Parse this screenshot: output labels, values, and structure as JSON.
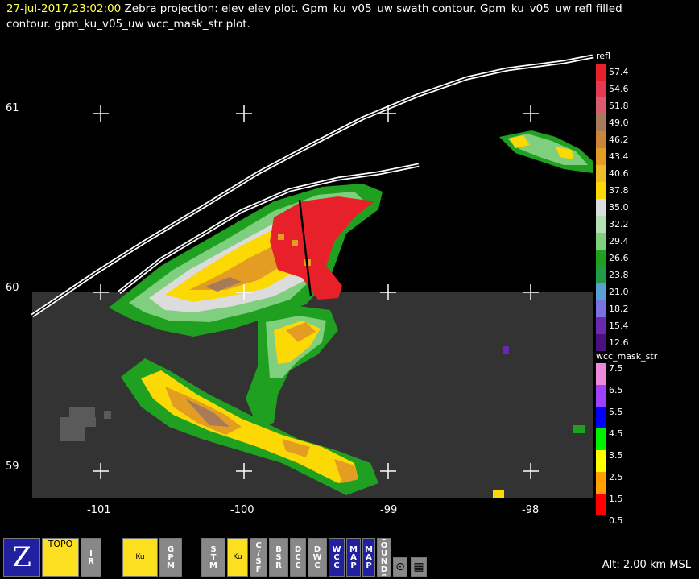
{
  "title": {
    "timestamp": "27-jul-2017,23:02:00",
    "text_line1": "  Zebra projection: elev elev  plot.  Gpm_ku_v05_uw swath contour.  Gpm_ku_v05_uw refl filled",
    "text_line2": "contour.  gpm_ku_v05_uw wcc_mask_str  plot."
  },
  "axes": {
    "lat_labels": [
      "61",
      "60",
      "59"
    ],
    "lon_labels": [
      "-101",
      "-100",
      "-99",
      "-98"
    ]
  },
  "colorbars": {
    "refl": {
      "title": "refl",
      "labels": [
        "57.4",
        "54.6",
        "51.8",
        "49.0",
        "46.2",
        "43.4",
        "40.6",
        "37.8",
        "35.0",
        "32.2",
        "29.4",
        "26.6",
        "23.8",
        "21.0",
        "18.2",
        "15.4",
        "12.6"
      ],
      "colors": [
        "#e8202a",
        "#e23a50",
        "#d75c6f",
        "#a77a5a",
        "#c9853a",
        "#e39d22",
        "#f0bb2a",
        "#fcd804",
        "#dcdcdc",
        "#b4e0b4",
        "#7fcf7f",
        "#20a020",
        "#229a48",
        "#5a9fd3",
        "#7a72e0",
        "#6a28b0",
        "#4a1080"
      ]
    },
    "wcc": {
      "title": "wcc_mask_str",
      "labels": [
        "7.5",
        "6.5",
        "5.5",
        "4.5",
        "3.5",
        "2.5",
        "1.5",
        "0.5"
      ],
      "colors": [
        "#ee88dd",
        "#a040ff",
        "#0000ff",
        "#00ee00",
        "#ffff00",
        "#ffa000",
        "#ff0000"
      ]
    }
  },
  "toolbar": {
    "buttons": [
      {
        "name": "zebra-logo-button",
        "label": "Z"
      },
      {
        "name": "topo-button",
        "label": "TOPO"
      },
      {
        "name": "ir-button",
        "label": "IR"
      },
      {
        "name": "ku-swath-button",
        "label": "Ku"
      },
      {
        "name": "gpm-button",
        "label": "GPM"
      },
      {
        "name": "stm-button",
        "label": "STM"
      },
      {
        "name": "ku-gpm-vs-button",
        "label": "Ku"
      },
      {
        "name": "csf-gpm-button",
        "label": "C/SF"
      },
      {
        "name": "bsr-button",
        "label": "BSR"
      },
      {
        "name": "dcc-button",
        "label": "DCC"
      },
      {
        "name": "dwc-button",
        "label": "DWC"
      },
      {
        "name": "wcc-button",
        "label": "WCC"
      },
      {
        "name": "map-button",
        "label": "MAP"
      },
      {
        "name": "map2-button",
        "label": "MAP"
      },
      {
        "name": "sounds-button",
        "label": "SOUNDS"
      },
      {
        "name": "target-button",
        "label": "⊙"
      },
      {
        "name": "grid-button",
        "label": "▦"
      }
    ]
  },
  "status": {
    "altitude": "Alt: 2.00 km MSL"
  },
  "colors": {
    "background": "#000000",
    "data_region": "#333333",
    "swath_edge": "#ffffff"
  }
}
